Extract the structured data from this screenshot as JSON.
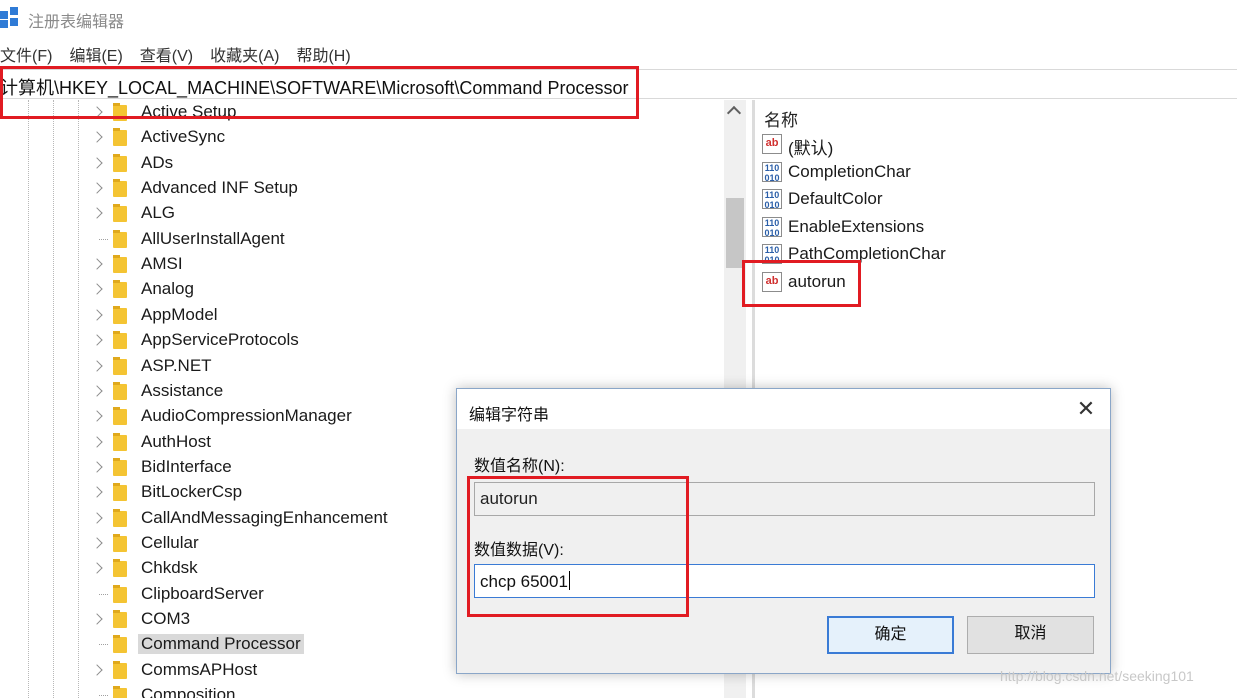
{
  "window": {
    "title": "注册表编辑器"
  },
  "menu": [
    {
      "label": "文件(F)"
    },
    {
      "label": "编辑(E)"
    },
    {
      "label": "查看(V)"
    },
    {
      "label": "收藏夹(A)"
    },
    {
      "label": "帮助(H)"
    }
  ],
  "address": {
    "path": "计算机\\HKEY_LOCAL_MACHINE\\SOFTWARE\\Microsoft\\Command Processor"
  },
  "tree": {
    "items": [
      {
        "label": "Active Setup",
        "expandable": true
      },
      {
        "label": "ActiveSync",
        "expandable": true
      },
      {
        "label": "ADs",
        "expandable": true
      },
      {
        "label": "Advanced INF Setup",
        "expandable": true
      },
      {
        "label": "ALG",
        "expandable": true
      },
      {
        "label": "AllUserInstallAgent",
        "expandable": false
      },
      {
        "label": "AMSI",
        "expandable": true
      },
      {
        "label": "Analog",
        "expandable": true
      },
      {
        "label": "AppModel",
        "expandable": true
      },
      {
        "label": "AppServiceProtocols",
        "expandable": true
      },
      {
        "label": "ASP.NET",
        "expandable": true
      },
      {
        "label": "Assistance",
        "expandable": true
      },
      {
        "label": "AudioCompressionManager",
        "expandable": true
      },
      {
        "label": "AuthHost",
        "expandable": true
      },
      {
        "label": "BidInterface",
        "expandable": true
      },
      {
        "label": "BitLockerCsp",
        "expandable": true
      },
      {
        "label": "CallAndMessagingEnhancement",
        "expandable": true
      },
      {
        "label": "Cellular",
        "expandable": true
      },
      {
        "label": "Chkdsk",
        "expandable": true
      },
      {
        "label": "ClipboardServer",
        "expandable": false
      },
      {
        "label": "COM3",
        "expandable": true
      },
      {
        "label": "Command Processor",
        "expandable": false,
        "selected": true
      },
      {
        "label": "CommsAPHost",
        "expandable": true
      },
      {
        "label": "Composition",
        "expandable": false
      }
    ]
  },
  "values": {
    "column_name": "名称",
    "items": [
      {
        "name": "(默认)",
        "type": "string"
      },
      {
        "name": "CompletionChar",
        "type": "binary"
      },
      {
        "name": "DefaultColor",
        "type": "binary"
      },
      {
        "name": "EnableExtensions",
        "type": "binary"
      },
      {
        "name": "PathCompletionChar",
        "type": "binary"
      },
      {
        "name": "autorun",
        "type": "string"
      }
    ]
  },
  "dialog": {
    "title": "编辑字符串",
    "close_glyph": "✕",
    "name_label": "数值名称(N):",
    "name_value": "autorun",
    "data_label": "数值数据(V):",
    "data_value": "chcp 65001",
    "ok_label": "确定",
    "cancel_label": "取消"
  },
  "icons": {
    "string": "ab",
    "binary": "110\n010"
  },
  "watermark": "http://blog.csdn.net/seeking101",
  "colors": {
    "highlight_box": "#e11b22",
    "folder": "#f4c433",
    "focus": "#3a7bd5"
  }
}
